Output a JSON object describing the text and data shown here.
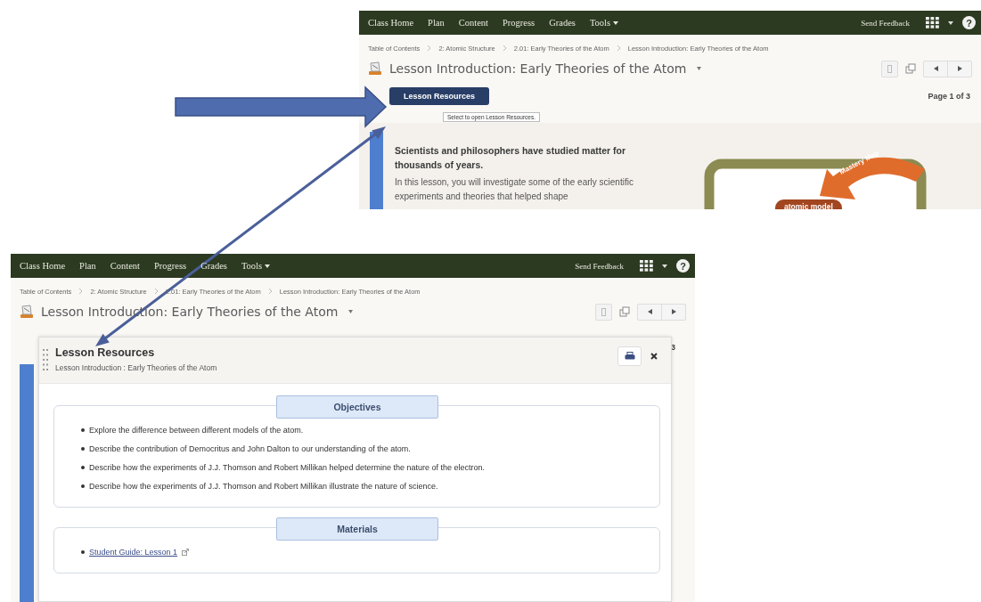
{
  "top_screen": {
    "nav": {
      "items": [
        {
          "label": "Class Home",
          "dropdown": false
        },
        {
          "label": "Plan",
          "dropdown": false
        },
        {
          "label": "Content",
          "dropdown": false
        },
        {
          "label": "Progress",
          "dropdown": false
        },
        {
          "label": "Grades",
          "dropdown": false
        },
        {
          "label": "Tools",
          "dropdown": true
        }
      ],
      "feedback": "Send Feedback",
      "help": "?"
    },
    "breadcrumb": [
      "Table of Contents",
      "2: Atomic Structure",
      "2.01: Early Theories of the Atom",
      "Lesson Introduction: Early Theories of the Atom"
    ],
    "title": "Lesson Introduction: Early Theories of the Atom",
    "resources_button": "Lesson Resources",
    "tooltip": "Select to open Lesson Resources.",
    "page_label": "Page 1 of 3",
    "intro_heading": "Scientists and philosophers have studied matter for thousands of years.",
    "intro_text": "In this lesson, you will investigate some of the early scientific experiments and theories that helped shape",
    "map": {
      "banner": "Mastery Map",
      "node": "atomic model"
    }
  },
  "bottom_screen": {
    "nav": {
      "items": [
        {
          "label": "Class Home",
          "dropdown": false
        },
        {
          "label": "Plan",
          "dropdown": false
        },
        {
          "label": "Content",
          "dropdown": false
        },
        {
          "label": "Progress",
          "dropdown": false
        },
        {
          "label": "Grades",
          "dropdown": false
        },
        {
          "label": "Tools",
          "dropdown": true
        }
      ],
      "feedback": "Send Feedback",
      "help": "?"
    },
    "breadcrumb": [
      "Table of Contents",
      "2: Atomic Structure",
      "2.01: Early Theories of the Atom",
      "Lesson Introduction: Early Theories of the Atom"
    ],
    "title": "Lesson Introduction: Early Theories of the Atom",
    "page_label": "3",
    "dialog": {
      "title": "Lesson Resources",
      "subtitle": "Lesson Introduction : Early Theories of the Atom",
      "sections": [
        {
          "kind": "list",
          "heading": "Objectives",
          "items": [
            "Explore the difference between different models of the atom.",
            "Describe the contribution of Democritus and John Dalton to our understanding of the atom.",
            "Describe how the experiments of J.J. Thomson and Robert Millikan helped determine the nature of the electron.",
            "Describe how the experiments of J.J. Thomson and Robert Millikan illustrate the nature of science."
          ]
        },
        {
          "kind": "links",
          "heading": "Materials",
          "items": [
            "Student Guide: Lesson 1"
          ]
        }
      ]
    }
  }
}
